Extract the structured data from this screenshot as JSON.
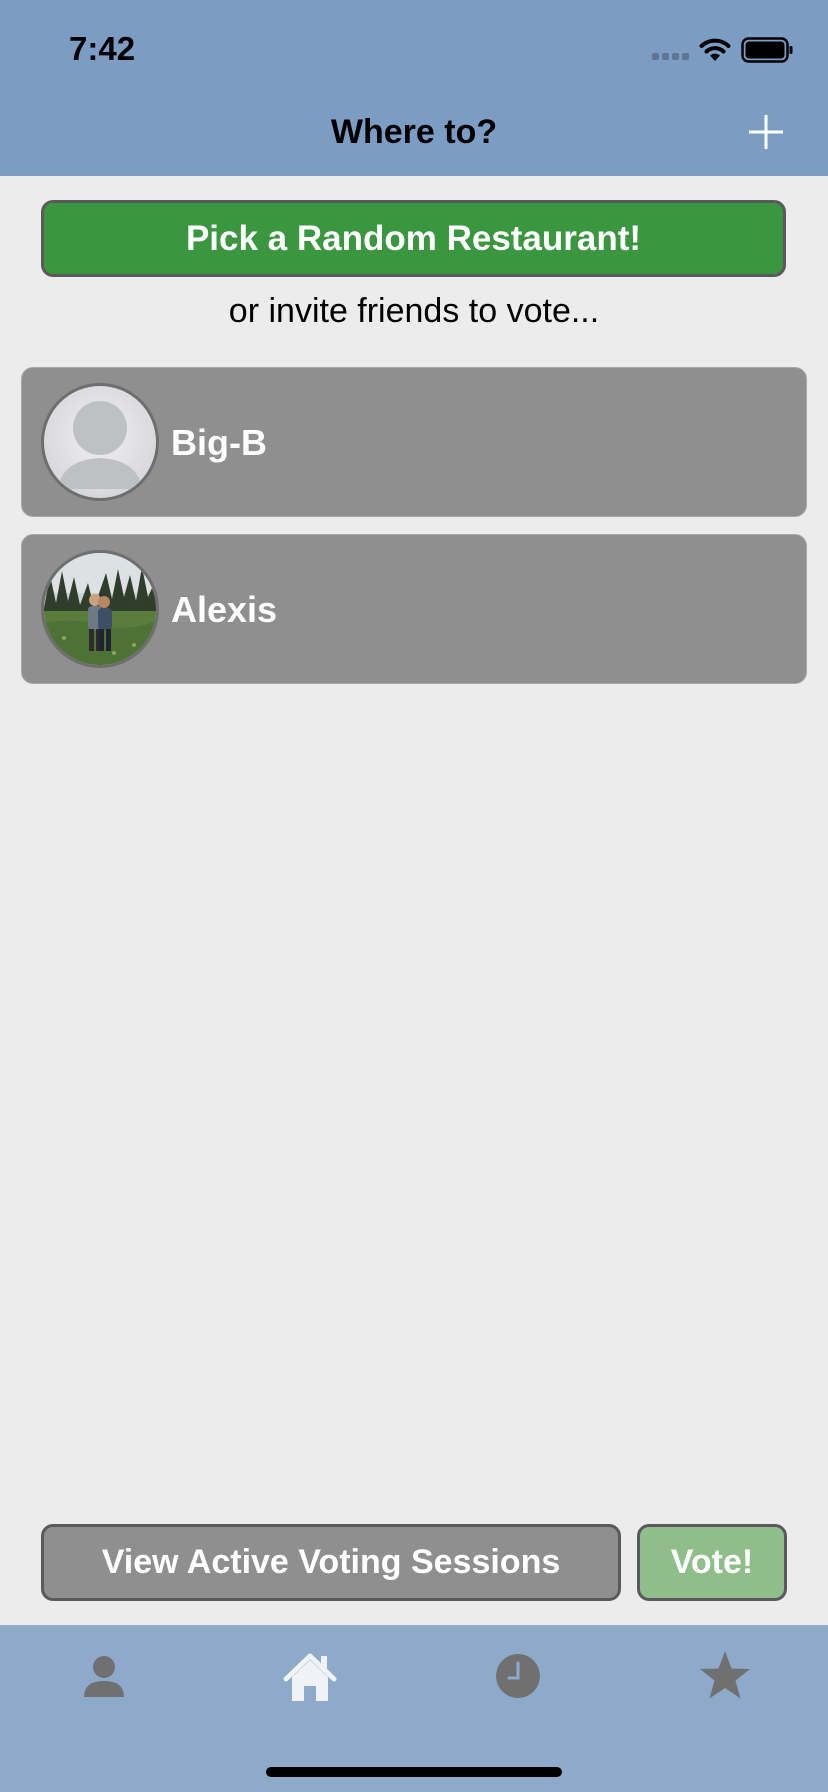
{
  "status_bar": {
    "time": "7:42"
  },
  "nav": {
    "title": "Where to?",
    "add_icon": "plus-icon"
  },
  "random_button_label": "Pick a Random Restaurant!",
  "subtitle": "or invite friends to vote...",
  "friends": [
    {
      "name": "Big-B",
      "avatar": "default-person-avatar"
    },
    {
      "name": "Alexis",
      "avatar": "photo-avatar"
    }
  ],
  "bottom_actions": {
    "sessions_label": "View Active Voting Sessions",
    "vote_label": "Vote!"
  },
  "tab_bar": {
    "tabs": [
      {
        "icon": "person-icon",
        "active": false
      },
      {
        "icon": "home-icon",
        "active": true
      },
      {
        "icon": "clock-icon",
        "active": false
      },
      {
        "icon": "star-icon",
        "active": false
      }
    ]
  },
  "colors": {
    "header": "#7b9dc4",
    "tab_bar": "#8eaaca",
    "background": "#ececec",
    "primary_green": "#3a963f",
    "vote_green": "#8fbe8b",
    "card_gray": "#8f8f8f"
  }
}
